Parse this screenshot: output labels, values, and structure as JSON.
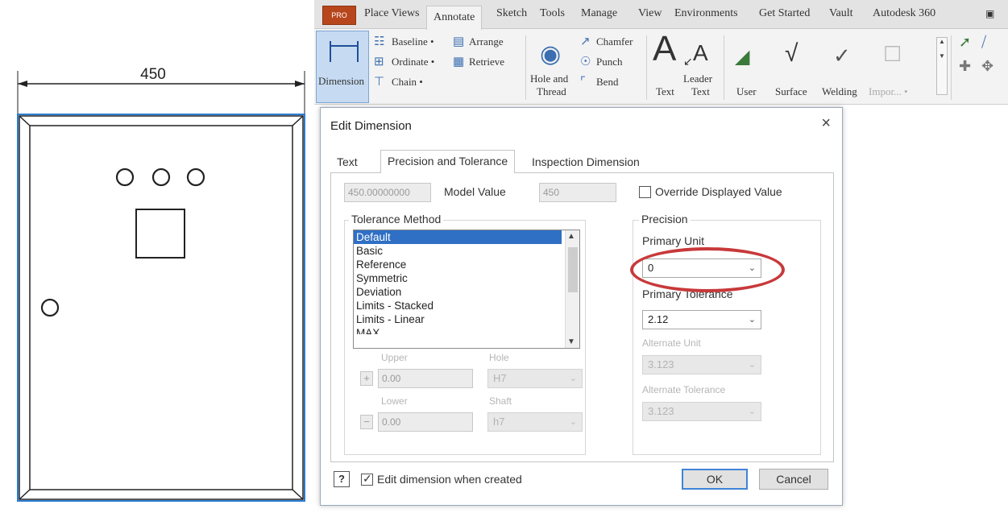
{
  "drawing": {
    "dimension_value": "450"
  },
  "ribbon": {
    "app_button": "PRO",
    "tabs": [
      "Place Views",
      "Annotate",
      "Sketch",
      "Tools",
      "Manage",
      "View",
      "Environments",
      "Get Started",
      "Vault",
      "Autodesk 360"
    ],
    "active_tab": "Annotate",
    "dimension": {
      "label": "Dimension",
      "icon": "dimension-icon"
    },
    "small_tools": [
      {
        "label": "Baseline •",
        "icon": "baseline-icon"
      },
      {
        "label": "Ordinate •",
        "icon": "ordinate-icon"
      },
      {
        "label": "Chain •",
        "icon": "chain-icon"
      },
      {
        "label": "Arrange",
        "icon": "arrange-icon"
      },
      {
        "label": "Retrieve",
        "icon": "retrieve-icon"
      }
    ],
    "hole_thread": {
      "line1": "Hole and",
      "line2": "Thread",
      "icon": "hole-thread-icon"
    },
    "feature_notes": [
      {
        "label": "Chamfer",
        "icon": "chamfer-icon"
      },
      {
        "label": "Punch",
        "icon": "punch-icon"
      },
      {
        "label": "Bend",
        "icon": "bend-icon"
      }
    ],
    "text_tools": {
      "text": "Text",
      "leader_text_line1": "Leader",
      "leader_text_line2": "Text",
      "glyph": "A"
    },
    "symbols": {
      "user": "User",
      "surface": "Surface",
      "welding": "Welding",
      "import": "Impor... •"
    }
  },
  "dialog": {
    "title": "Edit Dimension",
    "tabs": [
      "Text",
      "Precision and Tolerance",
      "Inspection Dimension"
    ],
    "active_tab": "Precision and Tolerance",
    "model_value_field": "450.00000000",
    "model_value_label": "Model Value",
    "model_value_short": "450",
    "override_label": "Override Displayed Value",
    "override_checked": false,
    "tolerance_method": {
      "title": "Tolerance Method",
      "items": [
        "Default",
        "Basic",
        "Reference",
        "Symmetric",
        "Deviation",
        "Limits - Stacked",
        "Limits - Linear",
        "MAX"
      ],
      "selected": "Default"
    },
    "upper_label": "Upper",
    "hole_label": "Hole",
    "upper_value": "0.00",
    "hole_value": "H7",
    "lower_label": "Lower",
    "shaft_label": "Shaft",
    "lower_value": "0.00",
    "shaft_value": "h7",
    "plus_sign": "+",
    "minus_sign": "−",
    "precision": {
      "title": "Precision",
      "primary_unit_label": "Primary Unit",
      "primary_unit_value": "0",
      "primary_tolerance_label": "Primary Tolerance",
      "primary_tolerance_value": "2.12",
      "alternate_unit_label": "Alternate Unit",
      "alternate_unit_value": "3.123",
      "alternate_tolerance_label": "Alternate Tolerance",
      "alternate_tolerance_value": "3.123"
    },
    "help": "?",
    "edit_when_created_label": "Edit dimension when created",
    "edit_when_created_checked": true,
    "ok": "OK",
    "cancel": "Cancel",
    "close": "×"
  },
  "colors": {
    "highlight": "#c8393a",
    "selection": "#2f6fc4",
    "drawing_blue": "#2b7cd3"
  }
}
